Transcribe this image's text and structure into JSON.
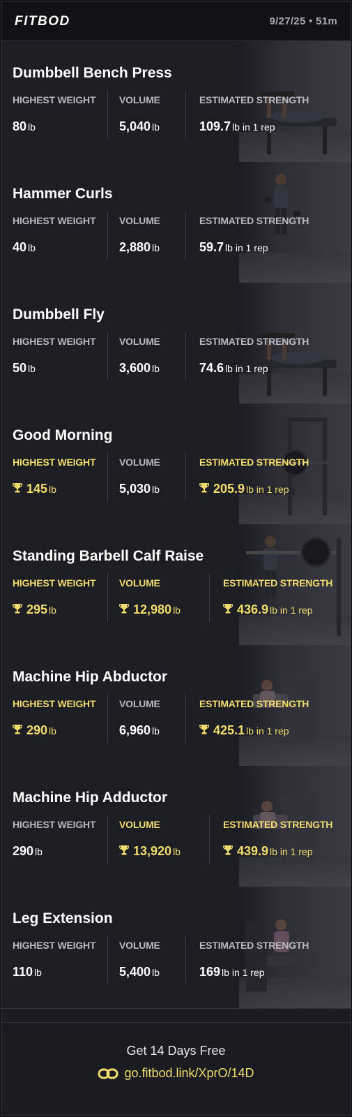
{
  "header": {
    "logo": "FITBOD",
    "meta": "9/27/25 • 51m"
  },
  "colors": {
    "accent": "#f1dd6e",
    "background": "#1d1d24",
    "label": "#b9b9c4"
  },
  "exercises": [
    {
      "name": "Dumbbell Bench Press",
      "stats": [
        {
          "label": "HIGHEST WEIGHT",
          "value": "80",
          "unit": "lb",
          "pr": false
        },
        {
          "label": "VOLUME",
          "value": "5,040",
          "unit": "lb",
          "pr": false
        },
        {
          "label": "ESTIMATED STRENGTH",
          "value": "109.7",
          "unit": "lb in 1 rep",
          "pr": false
        }
      ]
    },
    {
      "name": "Hammer Curls",
      "stats": [
        {
          "label": "HIGHEST WEIGHT",
          "value": "40",
          "unit": "lb",
          "pr": false
        },
        {
          "label": "VOLUME",
          "value": "2,880",
          "unit": "lb",
          "pr": false
        },
        {
          "label": "ESTIMATED STRENGTH",
          "value": "59.7",
          "unit": "lb in 1 rep",
          "pr": false
        }
      ]
    },
    {
      "name": "Dumbbell Fly",
      "stats": [
        {
          "label": "HIGHEST WEIGHT",
          "value": "50",
          "unit": "lb",
          "pr": false
        },
        {
          "label": "VOLUME",
          "value": "3,600",
          "unit": "lb",
          "pr": false
        },
        {
          "label": "ESTIMATED STRENGTH",
          "value": "74.6",
          "unit": "lb in 1 rep",
          "pr": false
        }
      ]
    },
    {
      "name": "Good Morning",
      "stats": [
        {
          "label": "HIGHEST WEIGHT",
          "value": "145",
          "unit": "lb",
          "pr": true
        },
        {
          "label": "VOLUME",
          "value": "5,030",
          "unit": "lb",
          "pr": false
        },
        {
          "label": "ESTIMATED STRENGTH",
          "value": "205.9",
          "unit": "lb in 1 rep",
          "pr": true
        }
      ]
    },
    {
      "name": "Standing Barbell Calf Raise",
      "stats": [
        {
          "label": "HIGHEST WEIGHT",
          "value": "295",
          "unit": "lb",
          "pr": true
        },
        {
          "label": "VOLUME",
          "value": "12,980",
          "unit": "lb",
          "pr": true
        },
        {
          "label": "ESTIMATED STRENGTH",
          "value": "436.9",
          "unit": "lb in 1 rep",
          "pr": true
        }
      ]
    },
    {
      "name": "Machine Hip Abductor",
      "stats": [
        {
          "label": "HIGHEST WEIGHT",
          "value": "290",
          "unit": "lb",
          "pr": true
        },
        {
          "label": "VOLUME",
          "value": "6,960",
          "unit": "lb",
          "pr": false
        },
        {
          "label": "ESTIMATED STRENGTH",
          "value": "425.1",
          "unit": "lb in 1 rep",
          "pr": true
        }
      ]
    },
    {
      "name": "Machine Hip Adductor",
      "stats": [
        {
          "label": "HIGHEST WEIGHT",
          "value": "290",
          "unit": "lb",
          "pr": false
        },
        {
          "label": "VOLUME",
          "value": "13,920",
          "unit": "lb",
          "pr": true
        },
        {
          "label": "ESTIMATED STRENGTH",
          "value": "439.9",
          "unit": "lb in 1 rep",
          "pr": true
        }
      ]
    },
    {
      "name": "Leg Extension",
      "stats": [
        {
          "label": "HIGHEST WEIGHT",
          "value": "110",
          "unit": "lb",
          "pr": false
        },
        {
          "label": "VOLUME",
          "value": "5,400",
          "unit": "lb",
          "pr": false
        },
        {
          "label": "ESTIMATED STRENGTH",
          "value": "169",
          "unit": "lb in 1 rep",
          "pr": false
        }
      ]
    }
  ],
  "footer": {
    "cta": "Get 14 Days Free",
    "link": "go.fitbod.link/XprO/14D"
  }
}
